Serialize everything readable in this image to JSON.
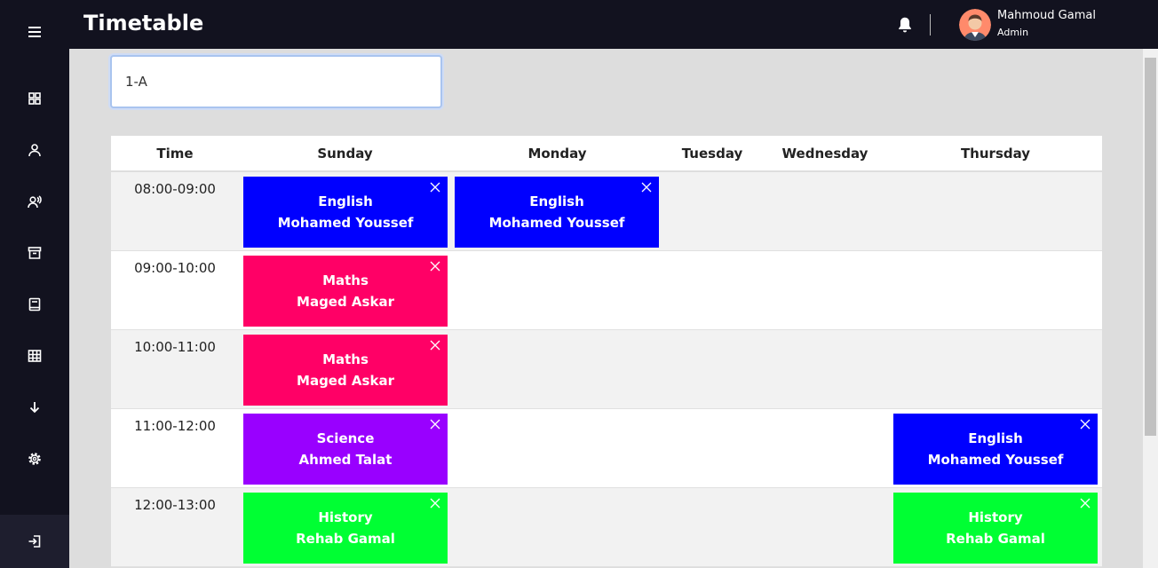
{
  "header": {
    "title": "Timetable",
    "user_name": "Mahmoud Gamal",
    "user_role": "Admin"
  },
  "sidebar": {
    "items": [
      "menu-icon",
      "dashboard-icon",
      "user-icon",
      "users-icon",
      "archive-icon",
      "book-icon",
      "table-icon",
      "download-icon",
      "gear-icon"
    ],
    "logout_icon": "logout-icon"
  },
  "class_select": {
    "value": "1-A"
  },
  "timetable": {
    "headers": [
      "Time",
      "Sunday",
      "Monday",
      "Tuesday",
      "Wednesday",
      "Thursday"
    ],
    "rows": [
      {
        "time": "08:00-09:00",
        "lessons": [
          {
            "subject": "English",
            "teacher": "Mohamed Youssef",
            "color": "#0000ff"
          },
          {
            "subject": "English",
            "teacher": "Mohamed Youssef",
            "color": "#0000ff"
          }
        ]
      },
      {
        "time": "09:00-10:00",
        "lessons": [
          {
            "subject": "Maths",
            "teacher": "Maged Askar",
            "color": "#ff0066"
          }
        ]
      },
      {
        "time": "10:00-11:00",
        "lessons": [
          {
            "subject": "Maths",
            "teacher": "Maged Askar",
            "color": "#ff0066"
          }
        ]
      },
      {
        "time": "11:00-12:00",
        "lessons": [
          {
            "subject": "Science",
            "teacher": "Ahmed Talat",
            "color": "#9900ff"
          },
          {
            "subject": "English",
            "teacher": "Mohamed Youssef",
            "color": "#0000ff"
          }
        ]
      },
      {
        "time": "12:00-13:00",
        "lessons": [
          {
            "subject": "History",
            "teacher": "Rehab Gamal",
            "color": "#00ff33"
          },
          {
            "subject": "History",
            "teacher": "Rehab Gamal",
            "color": "#00ff33"
          }
        ]
      }
    ]
  },
  "colors": {
    "sidebar": "#12121f",
    "topbar": "#12121f",
    "background": "#dddddd"
  }
}
